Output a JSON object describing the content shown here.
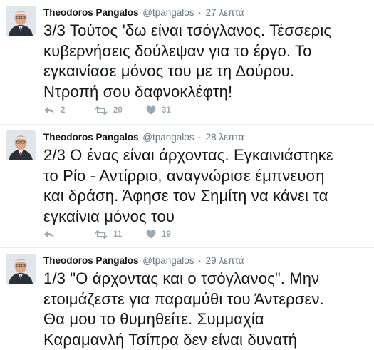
{
  "tweets": [
    {
      "name": "Theodoros Pangalos",
      "handle": "@tpangalos",
      "separator": "·",
      "time": "27 λεπτά",
      "lines": [
        "3/3 Τούτος 'δω είναι τσόγλανος. Τέσσερις",
        "κυβερνήσεις δούλεψαν για το έργο. Το",
        "εγκαινίασε μόνος του με τη Δούρου.",
        "Ντροπή σου δαφνοκλέφτη!"
      ],
      "replies": "2",
      "retweets": "20",
      "likes": "31"
    },
    {
      "name": "Theodoros Pangalos",
      "handle": "@tpangalos",
      "separator": "·",
      "time": "28 λεπτά",
      "lines": [
        "2/3 Ο ένας είναι άρχοντας. Εγκαινιάστηκε",
        "το Ρίο - Αντίρριο, αναγνώρισε έμπνευση",
        "και δράση. Άφησε τον Σημίτη να κάνει τα",
        "εγκαίνια μόνος του"
      ],
      "replies": "",
      "retweets": "11",
      "likes": "19"
    },
    {
      "name": "Theodoros Pangalos",
      "handle": "@tpangalos",
      "separator": "·",
      "time": "29 λεπτά",
      "lines": [
        "1/3 \"Ο άρχοντας και ο τσόγλανος\". Μην",
        "ετοιμάζεστε για παραμύθι του Άντερσεν.",
        "Θα μου το θυμηθείτε. Συμμαχία",
        "Καραμανλή Τσίπρα δεν είναι δυνατή"
      ]
    }
  ],
  "icons": {
    "reply": "reply-icon",
    "retweet": "retweet-icon",
    "like": "heart-icon",
    "accent_gray": "#9aa8b3"
  }
}
